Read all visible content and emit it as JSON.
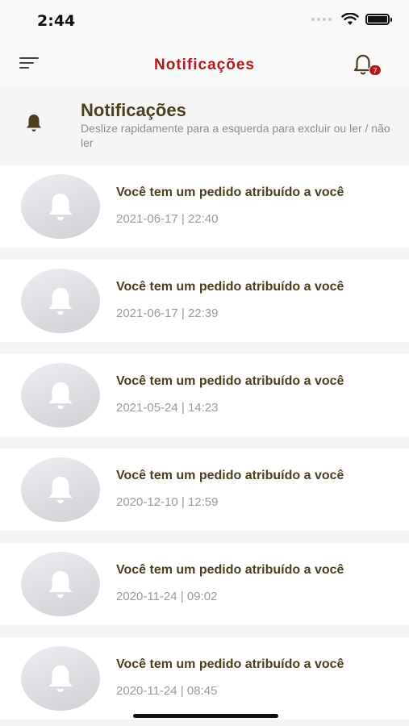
{
  "status_bar": {
    "time": "2:44"
  },
  "header": {
    "title": "Notificações",
    "badge_count": "7"
  },
  "section": {
    "title": "Notificações",
    "subtitle": "Deslize rapidamente para a esquerda para excluir ou ler / não ler"
  },
  "icons": {
    "menu": "menu-icon",
    "bell": "bell-icon",
    "avatar": "bell-icon"
  },
  "colors": {
    "accent": "#b01a1e",
    "title_text": "#4b3f1f",
    "date_text": "#9a9a9a"
  },
  "notifications": [
    {
      "title": "Você tem um pedido atribuído a você",
      "date": "2021-06-17 | 22:40"
    },
    {
      "title": "Você tem um pedido atribuído a você",
      "date": "2021-06-17 | 22:39"
    },
    {
      "title": "Você tem um pedido atribuído a você",
      "date": "2021-05-24 | 14:23"
    },
    {
      "title": "Você tem um pedido atribuído a você",
      "date": "2020-12-10 | 12:59"
    },
    {
      "title": "Você tem um pedido atribuído a você",
      "date": "2020-11-24 | 09:02"
    },
    {
      "title": "Você tem um pedido atribuído a você",
      "date": "2020-11-24 | 08:45"
    }
  ]
}
